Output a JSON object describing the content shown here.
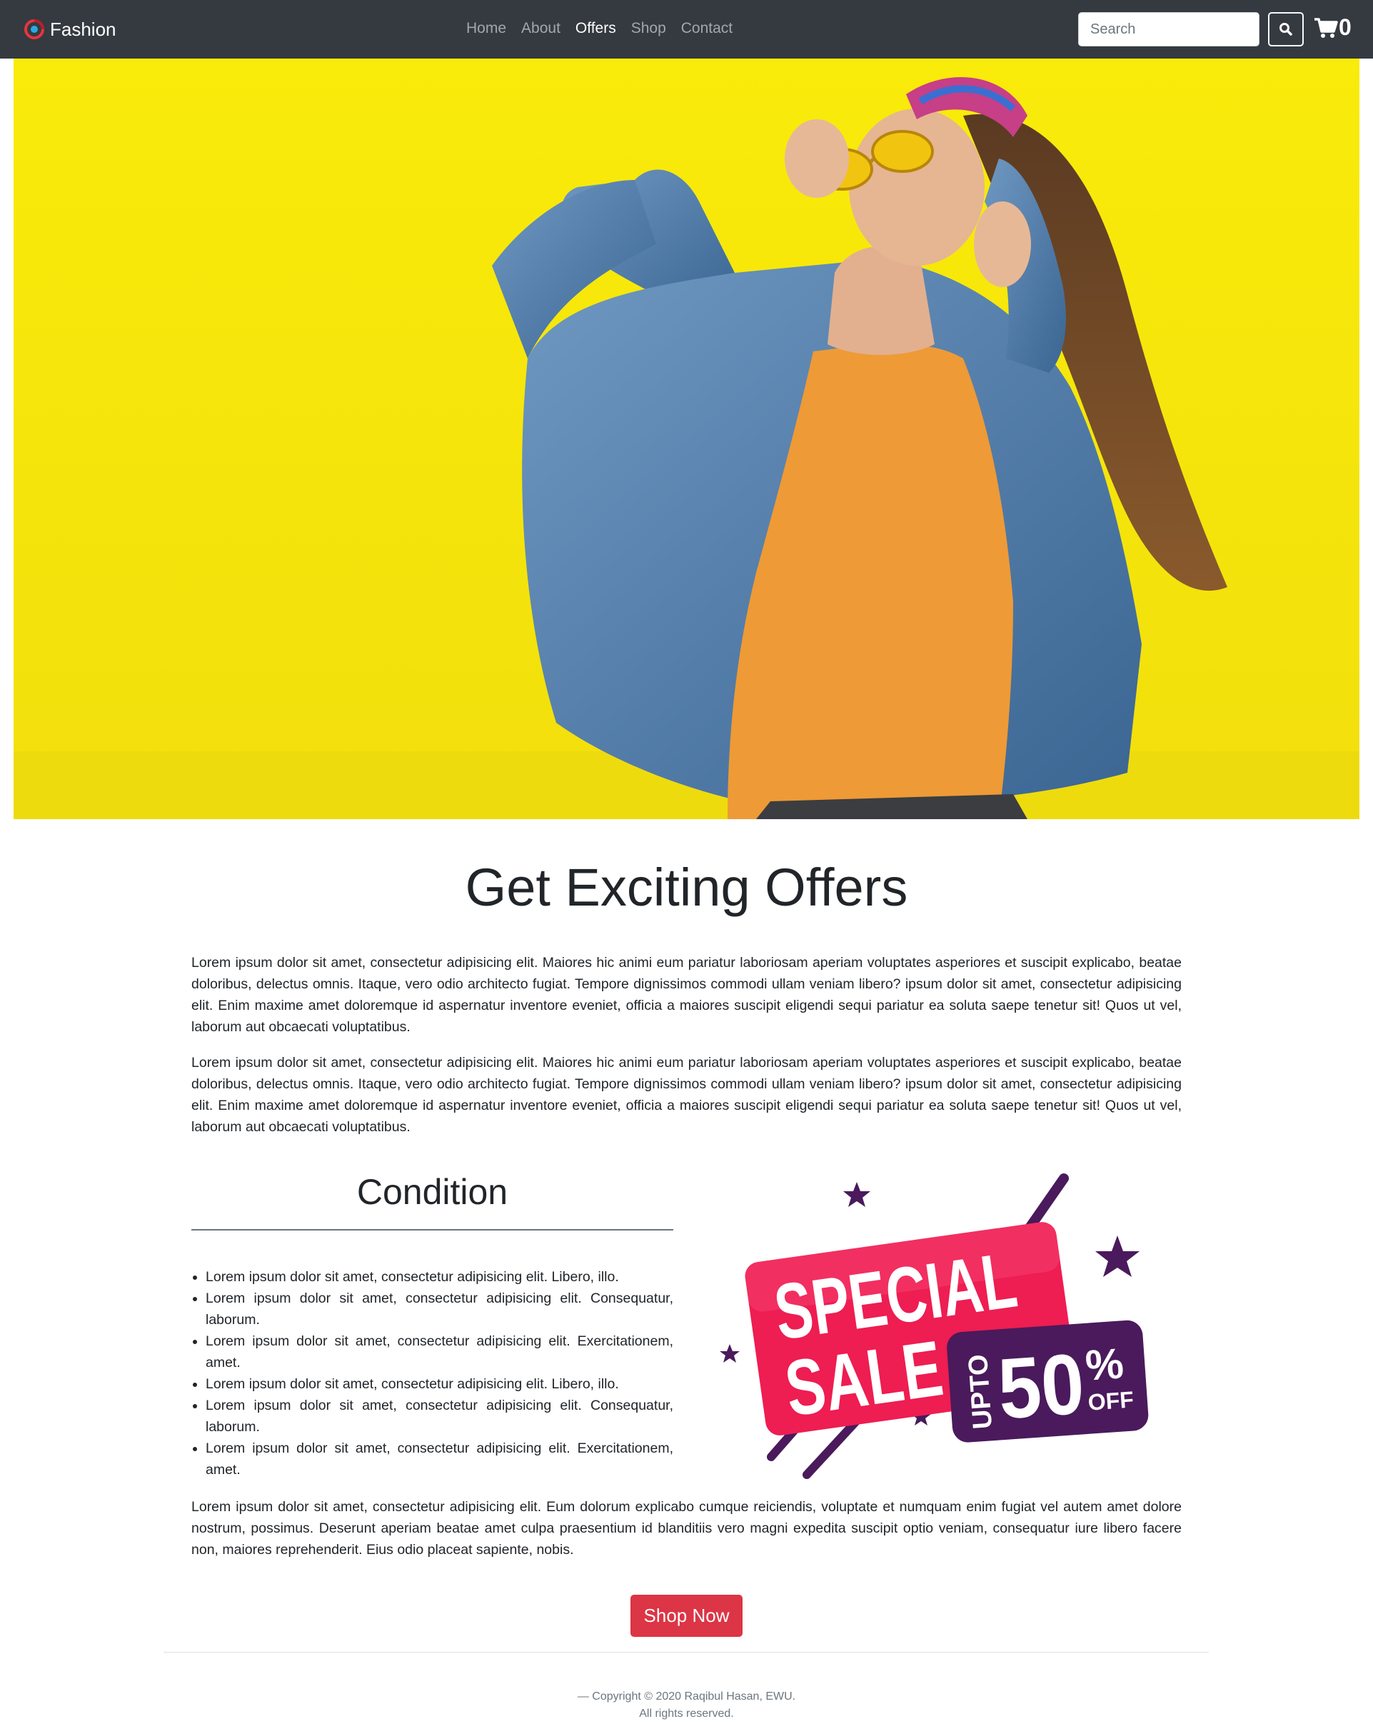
{
  "navbar": {
    "brand": "Fashion",
    "links": [
      {
        "label": "Home",
        "active": false
      },
      {
        "label": "About",
        "active": false
      },
      {
        "label": "Offers",
        "active": true
      },
      {
        "label": "Shop",
        "active": false
      },
      {
        "label": "Contact",
        "active": false
      }
    ],
    "search_placeholder": "Search",
    "cart_count": "0",
    "icons": {
      "brand": "brand-logo-icon",
      "search": "search-icon",
      "cart": "shopping-cart-icon"
    }
  },
  "hero": {
    "background_color": "#f7e80f"
  },
  "main": {
    "title": "Get Exciting Offers",
    "paragraphs": [
      "Lorem ipsum dolor sit amet, consectetur adipisicing elit. Maiores hic animi eum pariatur laboriosam aperiam voluptates asperiores et suscipit explicabo, beatae doloribus, delectus omnis. Itaque, vero odio architecto fugiat. Tempore dignissimos commodi ullam veniam libero? ipsum dolor sit amet, consectetur adipisicing elit. Enim maxime amet doloremque id aspernatur inventore eveniet, officia a maiores suscipit eligendi sequi pariatur ea soluta saepe tenetur sit! Quos ut vel, laborum aut obcaecati voluptatibus.",
      "Lorem ipsum dolor sit amet, consectetur adipisicing elit. Maiores hic animi eum pariatur laboriosam aperiam voluptates asperiores et suscipit explicabo, beatae doloribus, delectus omnis. Itaque, vero odio architecto fugiat. Tempore dignissimos commodi ullam veniam libero? ipsum dolor sit amet, consectetur adipisicing elit. Enim maxime amet doloremque id aspernatur inventore eveniet, officia a maiores suscipit eligendi sequi pariatur ea soluta saepe tenetur sit! Quos ut vel, laborum aut obcaecati voluptatibus."
    ],
    "condition": {
      "title": "Condition",
      "items": [
        "Lorem ipsum dolor sit amet, consectetur adipisicing elit. Libero, illo.",
        "Lorem ipsum dolor sit amet, consectetur adipisicing elit. Consequatur, laborum.",
        "Lorem ipsum dolor sit amet, consectetur adipisicing elit. Exercitationem, amet.",
        "Lorem ipsum dolor sit amet, consectetur adipisicing elit. Libero, illo.",
        "Lorem ipsum dolor sit amet, consectetur adipisicing elit. Consequatur, laborum.",
        "Lorem ipsum dolor sit amet, consectetur adipisicing elit. Exercitationem, amet."
      ]
    },
    "sale_banner": {
      "line1": "SPECIAL",
      "line2": "SALE",
      "upto": "UPTO",
      "percent": "50",
      "percent_sign": "%",
      "off": "OFF",
      "colors": {
        "pink": "#ee1d52",
        "purple": "#4a1a5c"
      }
    },
    "closing_paragraph": "Lorem ipsum dolor sit amet, consectetur adipisicing elit. Eum dolorum explicabo cumque reiciendis, voluptate et numquam enim fugiat vel autem amet dolore nostrum, possimus. Deserunt aperiam beatae amet culpa praesentium id blanditiis vero magni expedita suscipit optio veniam, consequatur iure libero facere non, maiores reprehenderit. Eius odio placeat sapiente, nobis.",
    "cta_label": "Shop Now",
    "cta_color": "#dc3545"
  },
  "footer": {
    "copyright": "— Copyright © 2020 Raqibul Hasan, EWU.",
    "rights": "All rights reserved."
  }
}
